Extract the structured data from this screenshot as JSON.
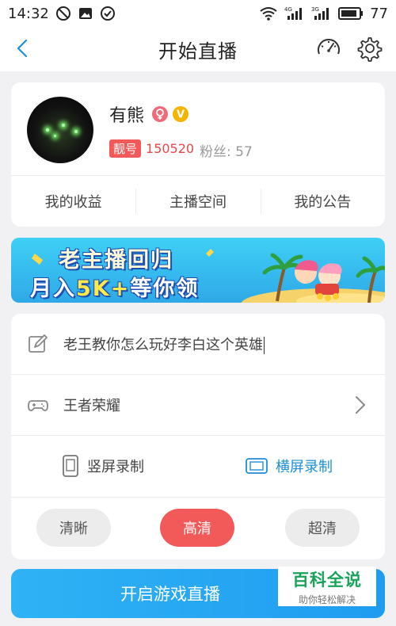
{
  "status_bar": {
    "time": "14:32",
    "battery": "77"
  },
  "navbar": {
    "title": "开始直播"
  },
  "profile": {
    "name": "有熊",
    "vip_badge": "V",
    "id_tag": "靓号",
    "id_number": "150520",
    "fans": "粉丝: 57",
    "menu": [
      "我的收益",
      "主播空间",
      "我的公告"
    ]
  },
  "banner": {
    "line1": "老主播回归",
    "line2_a": "月入",
    "line2_b": "5K+",
    "line2_c": "等你领"
  },
  "form": {
    "title_value": "老王教你怎么玩好李白这个英雄",
    "game_value": "王者荣耀",
    "orientation": {
      "portrait": "竖屏录制",
      "landscape": "横屏录制",
      "selected": "landscape"
    },
    "quality": {
      "options": [
        "清晰",
        "高清",
        "超清"
      ],
      "selected": "高清"
    }
  },
  "start_button": "开启游戏直播",
  "watermark": {
    "title": "百科全说",
    "subtitle": "助你轻松解决"
  },
  "colors": {
    "accent_blue": "#1f9cf0",
    "accent_red": "#f25a5a",
    "background": "#f1f1f3"
  }
}
